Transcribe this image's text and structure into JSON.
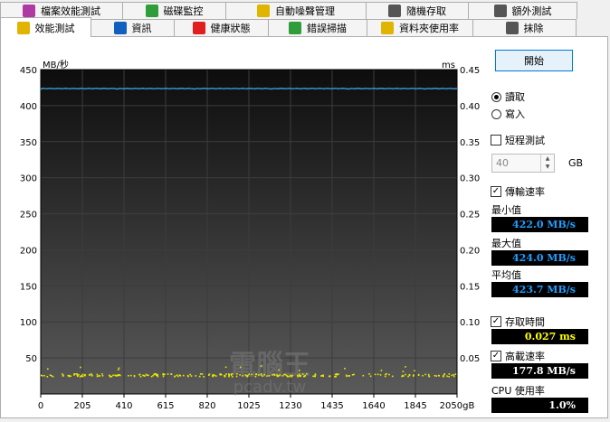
{
  "tabs_row1": [
    {
      "label": "檔案效能測試",
      "icon": "file-benchmark-icon",
      "color": "#b03aa4"
    },
    {
      "label": "磁碟監控",
      "icon": "disk-monitor-icon",
      "color": "#2f9e3a"
    },
    {
      "label": "自動噪聲管理",
      "icon": "speaker-icon",
      "color": "#e0b400"
    },
    {
      "label": "隨機存取",
      "icon": "random-access-icon",
      "color": "#555555"
    },
    {
      "label": "額外測試",
      "icon": "extra-tests-icon",
      "color": "#555555"
    }
  ],
  "tabs_row2": [
    {
      "label": "效能測試",
      "icon": "benchmark-icon",
      "color": "#e0b400",
      "active": true
    },
    {
      "label": "資訊",
      "icon": "info-icon",
      "color": "#1060c0",
      "active": false
    },
    {
      "label": "健康狀態",
      "icon": "health-cross-icon",
      "color": "#e02020",
      "active": false
    },
    {
      "label": "錯誤掃描",
      "icon": "error-scan-icon",
      "color": "#2f9e3a",
      "active": false
    },
    {
      "label": "資料夾使用率",
      "icon": "folder-usage-icon",
      "color": "#e0b400",
      "active": false
    },
    {
      "label": "抹除",
      "icon": "trash-icon",
      "color": "#555555",
      "active": false
    }
  ],
  "controls": {
    "start_label": "開始",
    "read_label": "讀取",
    "write_label": "寫入",
    "mode_selected": "read",
    "short_test_label": "短程測試",
    "short_test_checked": false,
    "short_test_value": "40",
    "short_test_unit": "GB",
    "transfer_rate_label": "傳輸速率",
    "transfer_rate_checked": true,
    "min_label": "最小值",
    "min_value": "422.0 MB/s",
    "max_label": "最大值",
    "max_value": "424.0 MB/s",
    "avg_label": "平均值",
    "avg_value": "423.7 MB/s",
    "access_time_label": "存取時間",
    "access_time_checked": true,
    "access_time_value": "0.027 ms",
    "burst_rate_label": "高載速率",
    "burst_rate_checked": true,
    "burst_rate_value": "177.8 MB/s",
    "cpu_label": "CPU 使用率",
    "cpu_value": "1.0%"
  },
  "watermark": {
    "line1": "電腦王",
    "line2": "pcadv.tw"
  },
  "chart_data": {
    "type": "line",
    "left_unit": "MB/秒",
    "right_unit": "ms",
    "x_ticks": [
      "0",
      "205",
      "410",
      "615",
      "820",
      "1025",
      "1230",
      "1435",
      "1640",
      "1845",
      "2050gB"
    ],
    "y_left_ticks": [
      50,
      100,
      150,
      200,
      250,
      300,
      350,
      400,
      450
    ],
    "y_right_ticks": [
      "0.05",
      "0.10",
      "0.15",
      "0.20",
      "0.25",
      "0.30",
      "0.35",
      "0.40",
      "0.45"
    ],
    "xlim": [
      0,
      2050
    ],
    "ylim": [
      0,
      450
    ],
    "y2lim": [
      0,
      0.45
    ],
    "grid": true,
    "series": [
      {
        "name": "傳輸速率",
        "color": "#3aa6e8",
        "axis": "left",
        "value": 423.7
      },
      {
        "name": "存取時間",
        "color": "#e8e800",
        "axis": "right",
        "type": "scatter",
        "value": 0.027
      }
    ]
  }
}
